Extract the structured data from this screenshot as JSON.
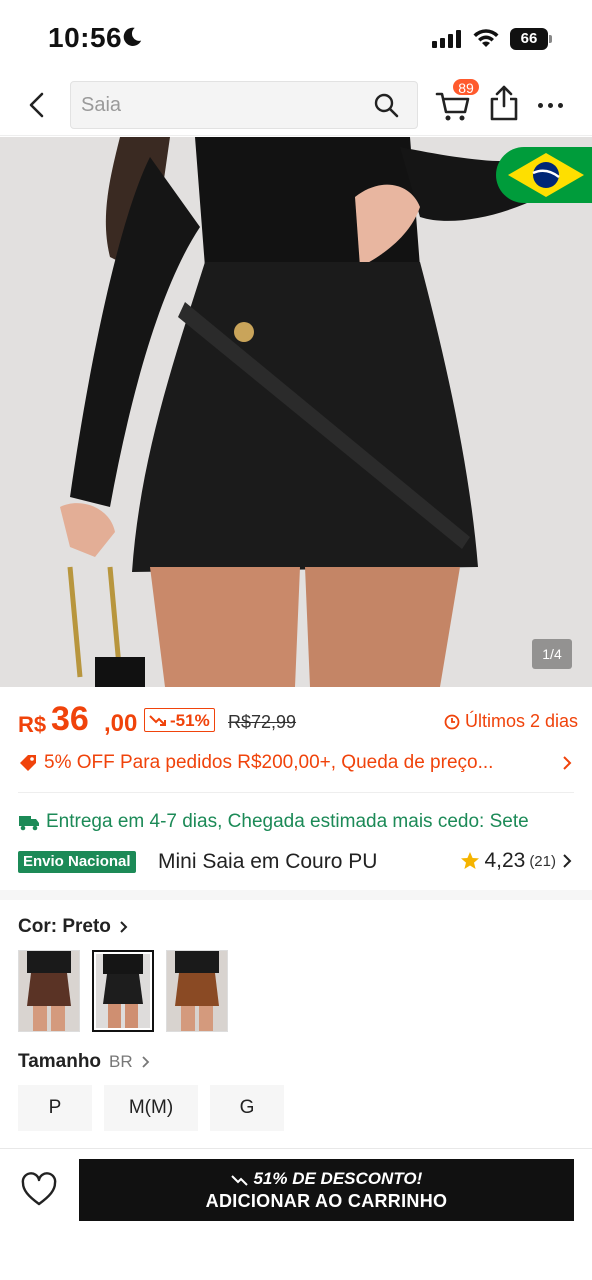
{
  "status_bar": {
    "time": "10:56",
    "battery": "66"
  },
  "header": {
    "search_placeholder": "Saia",
    "cart_count": "89"
  },
  "gallery": {
    "counter": "1/4",
    "flag": "brazil-flag-icon"
  },
  "price": {
    "currency": "R$",
    "amount": "36",
    "cents": ",00",
    "discount": "-51%",
    "original": "R$72,99",
    "urgency": "Últimos 2 dias"
  },
  "promo": {
    "text": "5% OFF Para pedidos R$200,00+,  Queda de preço..."
  },
  "delivery": {
    "text": "Entrega em 4-7 dias, Chegada estimada mais cedo: Sete"
  },
  "product": {
    "badge": "Envio Nacional",
    "title": "Mini Saia em Couro PU",
    "rating": "4,23",
    "review_count": "(21)"
  },
  "color": {
    "label": "Cor: Preto",
    "swatches": [
      "marrom",
      "preto",
      "caramelo"
    ],
    "selected_index": 1
  },
  "size": {
    "label": "Tamanho",
    "unit": "BR",
    "options": [
      "P",
      "M(M)",
      "G"
    ]
  },
  "cta": {
    "promo": "51% DE DESCONTO!",
    "label": "ADICIONAR AO CARRINHO"
  },
  "colors": {
    "accent": "#f0430b",
    "green": "#1c8a57",
    "cta_bg": "#111111"
  }
}
